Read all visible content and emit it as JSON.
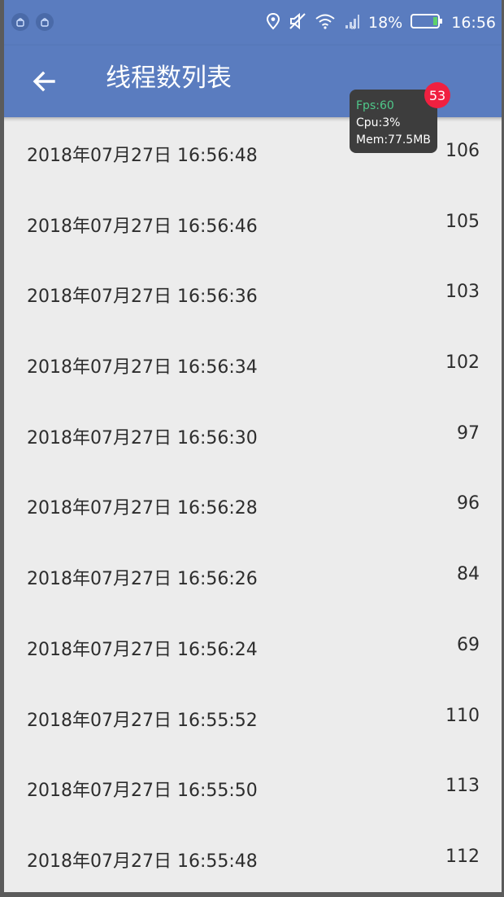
{
  "status_bar": {
    "battery_percent": "18%",
    "time": "16:56",
    "icons": [
      "android-icon",
      "android-icon",
      "location-icon",
      "mute-icon",
      "wifi-icon",
      "signal-icon",
      "battery-icon"
    ]
  },
  "toolbar": {
    "back_icon": "arrow-left-icon",
    "title": "线程数列表",
    "color": "#5a7cbf"
  },
  "perf_overlay": {
    "fps": "Fps:60",
    "cpu": "Cpu:3%",
    "mem": "Mem:77.5MB",
    "badge": "53"
  },
  "rows": [
    {
      "date": "2018年07月27日 16:56:48",
      "count": "106"
    },
    {
      "date": "2018年07月27日 16:56:46",
      "count": "105"
    },
    {
      "date": "2018年07月27日 16:56:36",
      "count": "103"
    },
    {
      "date": "2018年07月27日 16:56:34",
      "count": "102"
    },
    {
      "date": "2018年07月27日 16:56:30",
      "count": "97"
    },
    {
      "date": "2018年07月27日 16:56:28",
      "count": "96"
    },
    {
      "date": "2018年07月27日 16:56:26",
      "count": "84"
    },
    {
      "date": "2018年07月27日 16:56:24",
      "count": "69"
    },
    {
      "date": "2018年07月27日 16:55:52",
      "count": "110"
    },
    {
      "date": "2018年07月27日 16:55:50",
      "count": "113"
    },
    {
      "date": "2018年07月27日 16:55:48",
      "count": "112"
    }
  ]
}
